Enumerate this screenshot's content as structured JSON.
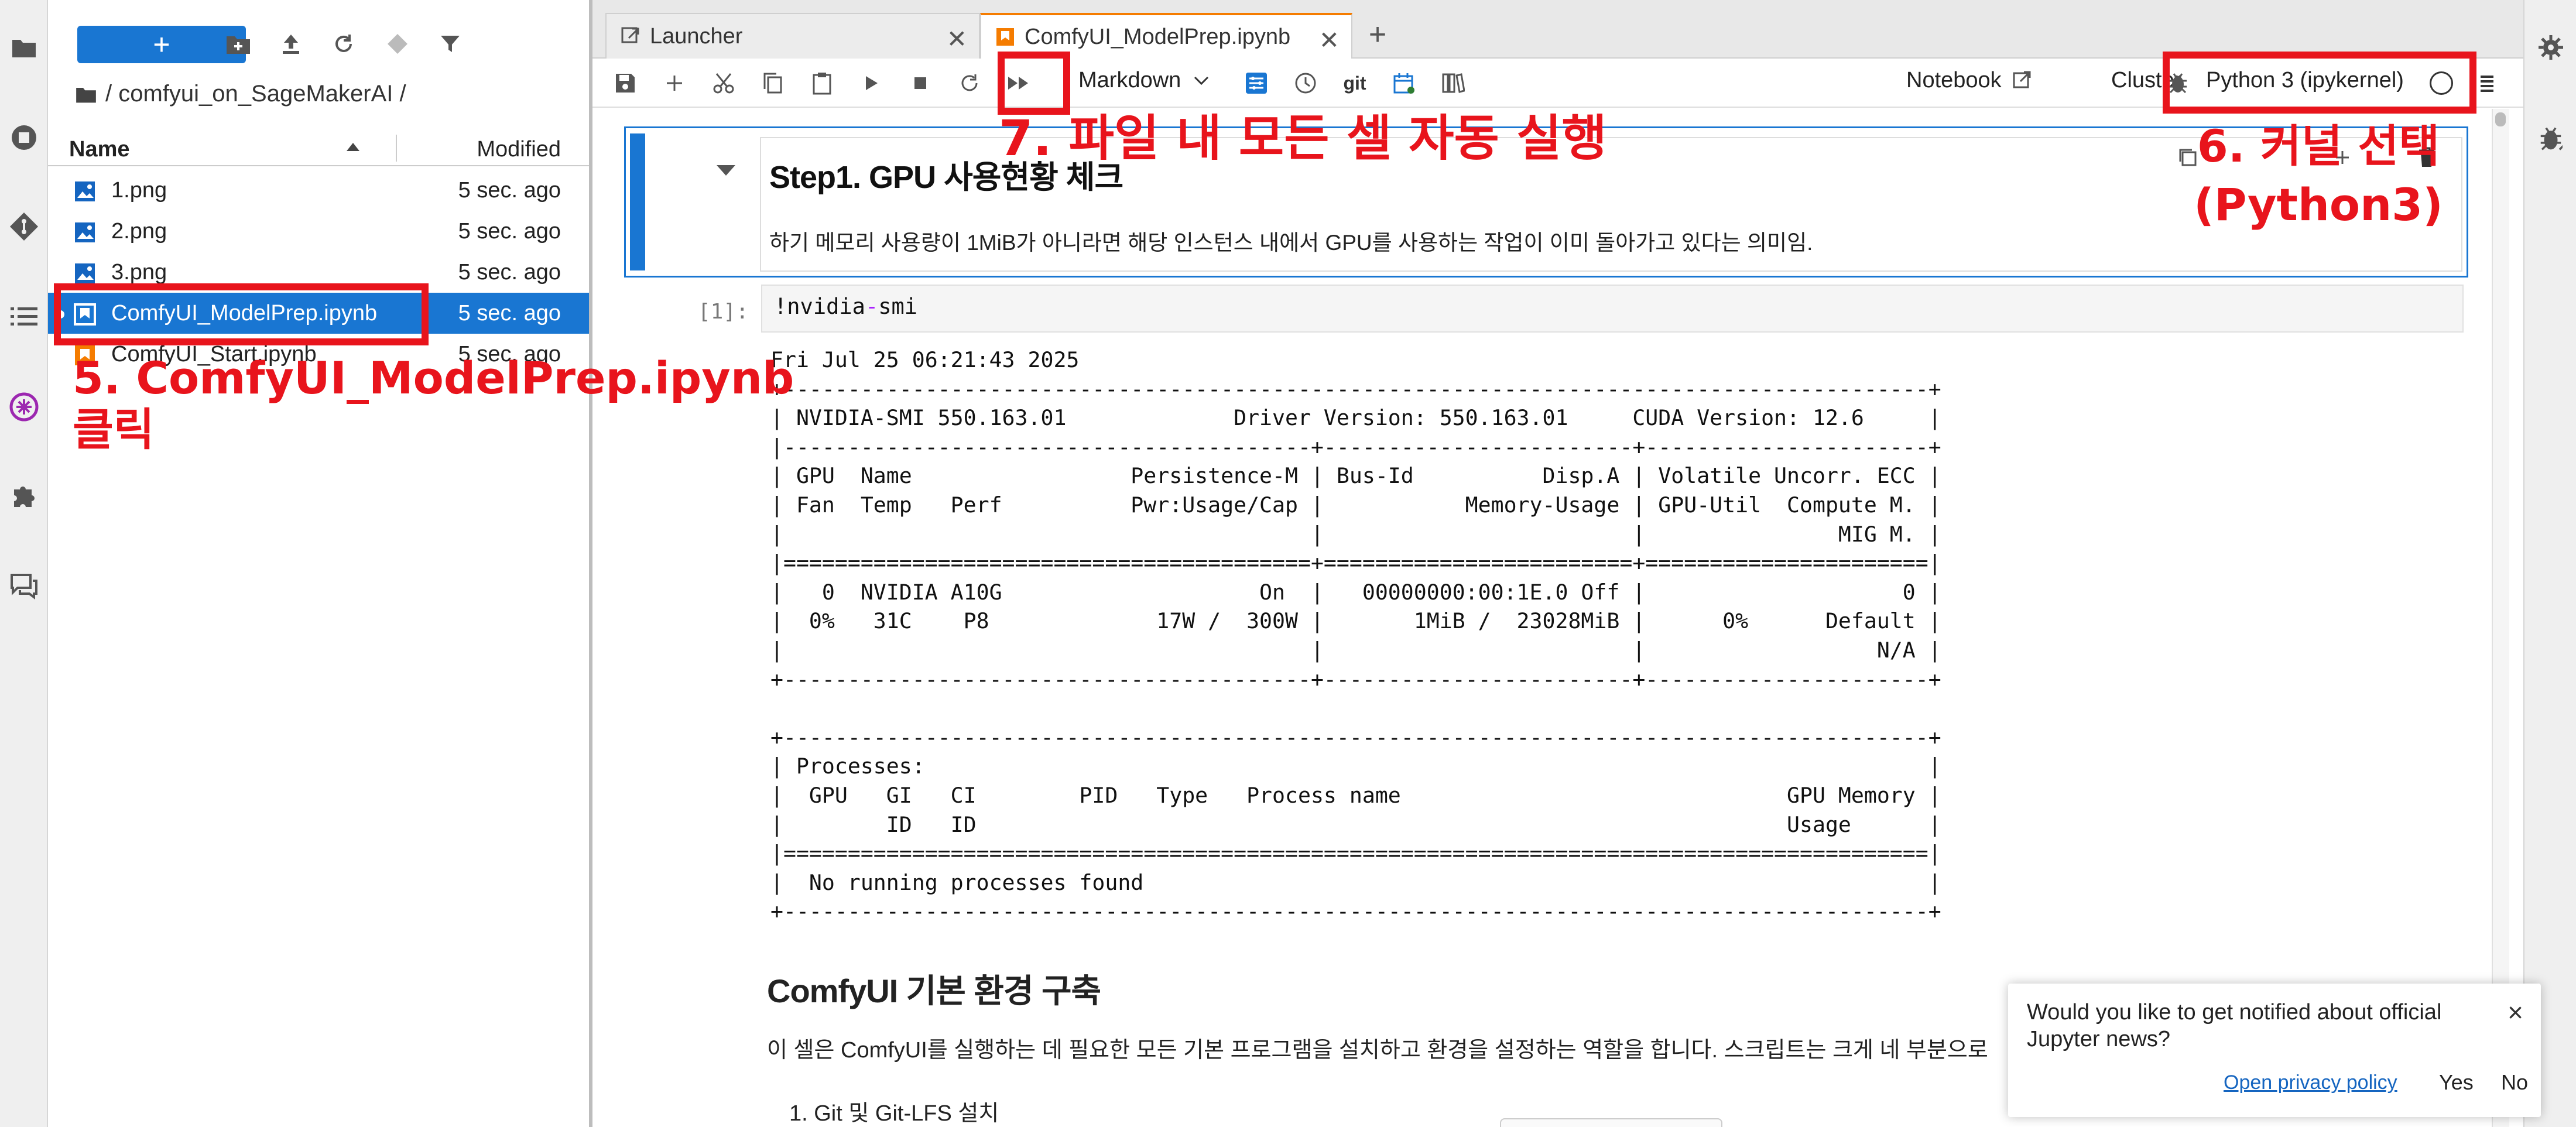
{
  "filebrowser": {
    "new_button_label": "+",
    "breadcrumb": "/ comfyui_on_SageMakerAI /",
    "columns": {
      "name": "Name",
      "modified": "Modified"
    },
    "files": [
      {
        "name": "1.png",
        "modified": "5 sec. ago",
        "type": "image"
      },
      {
        "name": "2.png",
        "modified": "5 sec. ago",
        "type": "image"
      },
      {
        "name": "3.png",
        "modified": "5 sec. ago",
        "type": "image"
      },
      {
        "name": "ComfyUI_ModelPrep.ipynb",
        "modified": "5 sec. ago",
        "type": "notebook",
        "selected": true
      },
      {
        "name": "ComfyUI_Start.ipynb",
        "modified": "5 sec. ago",
        "type": "notebook"
      }
    ]
  },
  "tabs": [
    {
      "label": "Launcher",
      "icon": "launcher-icon"
    },
    {
      "label": "ComfyUI_ModelPrep.ipynb",
      "icon": "notebook-icon",
      "active": true
    }
  ],
  "toolbar": {
    "cell_type": "Markdown",
    "git_label": "git",
    "notebook_label": "Notebook",
    "cluster_label": "Cluster",
    "kernel_label": "Python 3 (ipykernel)"
  },
  "notebook": {
    "md_cell": {
      "heading": "Step1. GPU 사용현황 체크",
      "text": "하기 메모리 사용량이 1MiB가 아니라면 해당 인스턴스 내에서 GPU를 사용하는 작업이 이미 돌아가고 있다는 의미임."
    },
    "code_cell": {
      "prompt": "[1]:",
      "code_prefix": "!nvidia",
      "code_op": "-",
      "code_suffix": "smi",
      "output_lines": [
        "Fri Jul 25 06:21:43 2025",
        "+-----------------------------------------------------------------------------------------+",
        "| NVIDIA-SMI 550.163.01             Driver Version: 550.163.01     CUDA Version: 12.6     |",
        "|-----------------------------------------+------------------------+----------------------+",
        "| GPU  Name                 Persistence-M | Bus-Id          Disp.A | Volatile Uncorr. ECC |",
        "| Fan  Temp   Perf          Pwr:Usage/Cap |           Memory-Usage | GPU-Util  Compute M. |",
        "|                                         |                        |               MIG M. |",
        "|=========================================+========================+======================|",
        "|   0  NVIDIA A10G                    On  |   00000000:00:1E.0 Off |                    0 |",
        "|  0%   31C    P8             17W /  300W |       1MiB /  23028MiB |      0%      Default |",
        "|                                         |                        |                  N/A |",
        "+-----------------------------------------+------------------------+----------------------+",
        "",
        "+-----------------------------------------------------------------------------------------+",
        "| Processes:                                                                              |",
        "|  GPU   GI   CI        PID   Type   Process name                              GPU Memory |",
        "|        ID   ID                                                               Usage      |",
        "|=========================================================================================|",
        "|  No running processes found                                                             |",
        "+-----------------------------------------------------------------------------------------+"
      ]
    },
    "md_cell2": {
      "heading": "ComfyUI 기본 환경 구축",
      "text": "이 셀은 ComfyUI를 실행하는 데 필요한 모든 기본 프로그램을 설치하고 환경을 설정하는 역할을 합니다. 스크립트는 크게 네 부분으로",
      "list_item": "1. Git 및 Git-LFS 설치"
    }
  },
  "toast": {
    "message": "Would you like to get notified about official Jupyter news?",
    "link": "Open privacy policy",
    "yes": "Yes",
    "no": "No",
    "close": "×"
  },
  "annotations": {
    "step5_line1": "5. ComfyUI_ModelPrep.ipynb",
    "step5_line2": "클릭",
    "step6_line1": "6. 커널 선택",
    "step6_line2": "(Python3)",
    "step7": "7. 파일 내 모든 셀 자동 실행",
    "color": "#e8141c"
  }
}
